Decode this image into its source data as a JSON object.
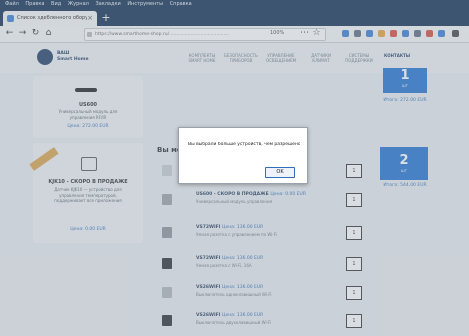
{
  "browser": {
    "menu": [
      "Файл",
      "Правка",
      "Вид",
      "Журнал",
      "Закладки",
      "Инструменты",
      "Справка"
    ],
    "tab_title": "Список здебленного оборуд",
    "url": "https://www.smarthome-shop.ru/..........................................",
    "zoom": "100%"
  },
  "site": {
    "logo_text": "ВАШ\nSmart Home",
    "nav": [
      "КОМПЛЕКТЫ\nSMART HOME",
      "БЕЗОПАСНОСТЬ\nПРИБОРОВ",
      "УПРАВЛЕНИЕ\nОСВЕЩЕНИЕМ",
      "ДАТЧИКИ\nКЛИМАТ",
      "СИСТЕМЫ\nПОДДЕРЖКИ",
      "КОНТАКТЫ"
    ]
  },
  "left_cards": [
    {
      "title": "US600",
      "desc": "Универсальный модуль для\nуправления RF/IR",
      "price": "Цена: 272.00 EUR"
    },
    {
      "title": "KJK10 - СКОРО В ПРОДАЖЕ",
      "desc": "Датчик KJK10 — устройство для\nуправления температурой,\nподдерживает все приложения",
      "price": "Цена: 0.00 EUR"
    }
  ],
  "right_boxes": [
    {
      "number": "1",
      "sub": "шт",
      "label": "Итого: 272.00 EUR"
    },
    {
      "number": "2",
      "sub": "шт",
      "label": "Итого: 544.00 EUR"
    }
  ],
  "section_title": "Вы мо",
  "rows": [
    {
      "title": "",
      "price": "",
      "desc": "",
      "qty": "1"
    },
    {
      "title": "US600 - СКОРО В ПРОДАЖЕ",
      "price": "Цена: 0.00 EUR",
      "desc": "Универсальный модуль управления",
      "qty": "1"
    },
    {
      "title": "VS72WIFI",
      "price": "Цена: 136.00 EUR",
      "desc": "Умная розетка с управлением по Wi-Fi",
      "qty": "1"
    },
    {
      "title": "VS72WIFI",
      "price": "Цена: 136.00 EUR",
      "desc": "Умная розетка с Wi-Fi, 16А",
      "qty": "1"
    },
    {
      "title": "VS26WIFI",
      "price": "Цена: 136.00 EUR",
      "desc": "Выключатель одноклавишный Wi-Fi",
      "qty": "1"
    },
    {
      "title": "VS26WIFI",
      "price": "Цена: 136.00 EUR",
      "desc": "Выключатель двухклавишный Wi-Fi",
      "qty": "1"
    }
  ],
  "dialog": {
    "message": "Вы выбрали больше устройств, чем разрешено 1",
    "ok_label": "OK"
  },
  "colors": {
    "accent": "#1f72d1",
    "chrome": "#0f2d52"
  }
}
